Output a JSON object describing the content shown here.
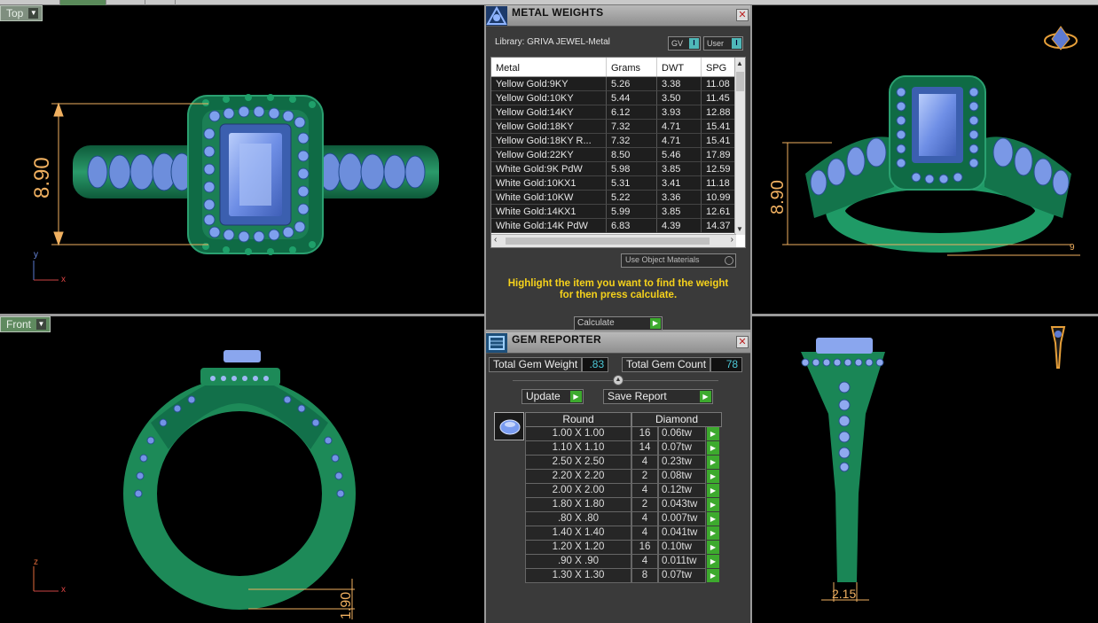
{
  "viewports": {
    "top": {
      "label": "Top",
      "dimension": "8.90",
      "axis_y": "y",
      "axis_x": "x"
    },
    "front": {
      "label": "Front",
      "dimension": "1.90",
      "axis_z": "z",
      "axis_x": "x"
    },
    "perspective": {
      "dimension": "8.90",
      "dimension_small": "9"
    },
    "right": {
      "dimension": "2.15"
    }
  },
  "metal_weights": {
    "title": "METAL WEIGHTS",
    "library": "Library: GRIVA JEWEL-Metal",
    "toggle_gv": "GV",
    "toggle_user": "User",
    "columns": [
      "Metal",
      "Grams",
      "DWT",
      "SPG"
    ],
    "rows": [
      {
        "metal": "Yellow Gold:9KY",
        "grams": "5.26",
        "dwt": "3.38",
        "spg": "11.08"
      },
      {
        "metal": "Yellow Gold:10KY",
        "grams": "5.44",
        "dwt": "3.50",
        "spg": "11.45"
      },
      {
        "metal": "Yellow Gold:14KY",
        "grams": "6.12",
        "dwt": "3.93",
        "spg": "12.88"
      },
      {
        "metal": "Yellow Gold:18KY",
        "grams": "7.32",
        "dwt": "4.71",
        "spg": "15.41"
      },
      {
        "metal": "Yellow Gold:18KY R...",
        "grams": "7.32",
        "dwt": "4.71",
        "spg": "15.41"
      },
      {
        "metal": "Yellow Gold:22KY",
        "grams": "8.50",
        "dwt": "5.46",
        "spg": "17.89"
      },
      {
        "metal": "White Gold:9K PdW",
        "grams": "5.98",
        "dwt": "3.85",
        "spg": "12.59"
      },
      {
        "metal": "White Gold:10KX1",
        "grams": "5.31",
        "dwt": "3.41",
        "spg": "11.18"
      },
      {
        "metal": "White Gold:10KW",
        "grams": "5.22",
        "dwt": "3.36",
        "spg": "10.99"
      },
      {
        "metal": "White Gold:14KX1",
        "grams": "5.99",
        "dwt": "3.85",
        "spg": "12.61"
      },
      {
        "metal": "White Gold:14K PdW",
        "grams": "6.83",
        "dwt": "4.39",
        "spg": "14.37"
      }
    ],
    "use_object_materials": "Use Object Materials",
    "hint": "Highlight the item you want to find the weight for then press calculate.",
    "calculate": "Calculate"
  },
  "gem_reporter": {
    "title": "GEM REPORTER",
    "total_weight_label": "Total Gem Weight",
    "total_weight_value": ".83",
    "total_count_label": "Total Gem Count",
    "total_count_value": "78",
    "update_label": "Update",
    "save_label": "Save Report",
    "shape_header": "Round",
    "material_header": "Diamond",
    "rows": [
      {
        "size": "1.00 X 1.00",
        "count": "16",
        "weight": "0.06tw"
      },
      {
        "size": "1.10 X 1.10",
        "count": "14",
        "weight": "0.07tw"
      },
      {
        "size": "2.50 X 2.50",
        "count": "4",
        "weight": "0.23tw"
      },
      {
        "size": "2.20 X 2.20",
        "count": "2",
        "weight": "0.08tw"
      },
      {
        "size": "2.00 X 2.00",
        "count": "4",
        "weight": "0.12tw"
      },
      {
        "size": "1.80 X 1.80",
        "count": "2",
        "weight": "0.043tw"
      },
      {
        "size": ".80 X .80",
        "count": "4",
        "weight": "0.007tw"
      },
      {
        "size": "1.40 X 1.40",
        "count": "4",
        "weight": "0.041tw"
      },
      {
        "size": "1.20 X 1.20",
        "count": "16",
        "weight": "0.10tw"
      },
      {
        "size": ".90 X .90",
        "count": "4",
        "weight": "0.011tw"
      },
      {
        "size": "1.30 X 1.30",
        "count": "8",
        "weight": "0.07tw"
      }
    ]
  },
  "colors": {
    "metal": "#1f8a5a",
    "gem": "#7a9cf0",
    "dimension": "#f0b060",
    "accent": "#3daa2e",
    "hint": "#f6d21b"
  },
  "icons": [
    "view-cube-icon",
    "dropdown-icon",
    "close-icon",
    "play-icon",
    "gem-round-icon",
    "radio-icon"
  ]
}
